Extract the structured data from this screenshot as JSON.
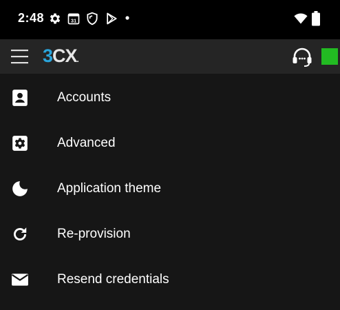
{
  "status_bar": {
    "time": "2:48",
    "icons": [
      "settings-icon",
      "calendar-icon",
      "shield-icon",
      "play-store-icon",
      "dot-icon",
      "wifi-icon",
      "battery-icon"
    ],
    "calendar_number": "31"
  },
  "app_bar": {
    "logo_part1": "3",
    "logo_part2": "CX",
    "logo_trademark": ".",
    "status_color": "#22bb22",
    "brand_color": "#2aa5dc"
  },
  "menu": {
    "items": [
      {
        "label": "Accounts",
        "icon": "account-box-icon"
      },
      {
        "label": "Advanced",
        "icon": "settings-box-icon"
      },
      {
        "label": "Application theme",
        "icon": "moon-icon"
      },
      {
        "label": "Re-provision",
        "icon": "refresh-icon"
      },
      {
        "label": "Resend credentials",
        "icon": "mail-icon"
      }
    ]
  }
}
